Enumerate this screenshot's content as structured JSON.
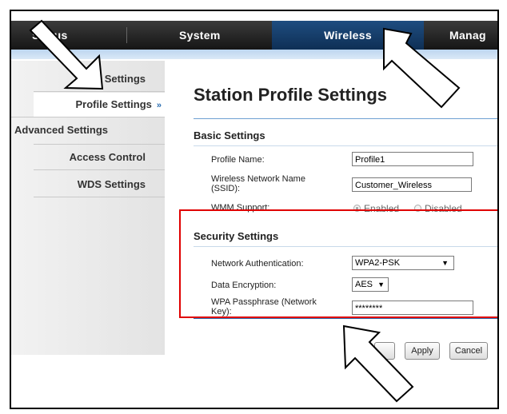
{
  "topnav": {
    "tabs": [
      {
        "label": "Status"
      },
      {
        "label": "System"
      },
      {
        "label": "Wireless",
        "active": true
      },
      {
        "label": "Manag"
      }
    ]
  },
  "sidebar": {
    "items": [
      {
        "label": "ic Settings"
      },
      {
        "label": "Profile Settings",
        "active": true,
        "marker": "»"
      },
      {
        "label": "Advanced Settings"
      },
      {
        "label": "Access Control"
      },
      {
        "label": "WDS Settings"
      }
    ]
  },
  "main": {
    "title": "Station Profile Settings",
    "basic": {
      "heading": "Basic Settings",
      "profile_name": {
        "label": "Profile Name:",
        "value": "Profile1"
      },
      "ssid": {
        "label": "Wireless Network Name (SSID):",
        "value": "Customer_Wireless"
      },
      "wmm": {
        "label": "WMM Support:",
        "options": [
          "Enabled",
          "Disabled"
        ],
        "selected": "Enabled"
      }
    },
    "security": {
      "heading": "Security Settings",
      "auth": {
        "label": "Network Authentication:",
        "value": "WPA2-PSK"
      },
      "encryption": {
        "label": "Data Encryption:",
        "value": "AES"
      },
      "passphrase": {
        "label": "WPA Passphrase (Network Key):",
        "value": "********"
      }
    },
    "buttons": {
      "apply": "Apply",
      "cancel": "Cancel"
    }
  },
  "colors": {
    "highlight_box": "#e00000",
    "active_tab": "#1f4d80",
    "accent_line": "#2a6db0"
  },
  "icons": [
    "pointer-arrow-icon",
    "caret-down-icon",
    "double-chevron-right-icon"
  ]
}
